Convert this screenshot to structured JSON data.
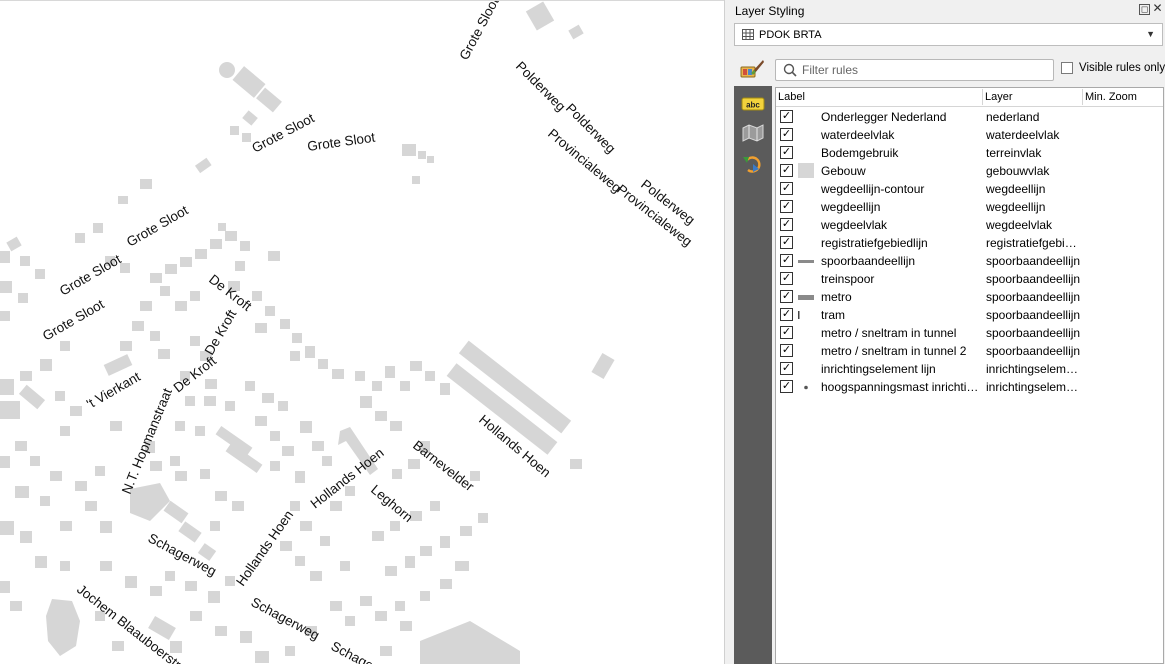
{
  "map": {
    "labels": [
      {
        "text": "Grote Sloot",
        "icon": "street-label"
      },
      {
        "text": "Grote Sloot"
      },
      {
        "text": "Grote Sloot"
      },
      {
        "text": "Grote Sloot"
      },
      {
        "text": "Grote Sloot"
      },
      {
        "text": "Grote Sloot"
      },
      {
        "text": "Polderweg"
      },
      {
        "text": "Polderweg"
      },
      {
        "text": "Polderweg"
      },
      {
        "text": "Provincialeweg"
      },
      {
        "text": "Provincialeweg"
      },
      {
        "text": "De Kroft"
      },
      {
        "text": "De Kroft"
      },
      {
        "text": "De Kroft"
      },
      {
        "text": "'t Vierkant"
      },
      {
        "text": "N.T. Hopmanstraat"
      },
      {
        "text": "Hollands Hoen"
      },
      {
        "text": "Hollands Hoen"
      },
      {
        "text": "Hollands Hoen"
      },
      {
        "text": "Barnevelder"
      },
      {
        "text": "Leghorn"
      },
      {
        "text": "Schagerweg"
      },
      {
        "text": "Schagerweg"
      },
      {
        "text": "Schager"
      },
      {
        "text": "Jochem Blaauboerstra"
      }
    ]
  },
  "panel": {
    "title": "Layer Styling",
    "layer_combo": {
      "value": "PDOK BRTA",
      "icon": "table-grid-icon"
    },
    "filter": {
      "placeholder": "Filter rules",
      "value": ""
    },
    "visible_only_label": "Visible rules only",
    "columns": [
      "Label",
      "Layer",
      "Min. Zoom"
    ],
    "rules": [
      {
        "label": "Onderlegger Nederland",
        "layer": "nederland",
        "symbol": "none",
        "checked": true
      },
      {
        "label": "waterdeelvlak",
        "layer": "waterdeelvlak",
        "symbol": "none",
        "checked": true
      },
      {
        "label": "Bodemgebruik",
        "layer": "terreinvlak",
        "symbol": "none",
        "checked": true
      },
      {
        "label": "Gebouw",
        "layer": "gebouwvlak",
        "symbol": "fill",
        "checked": true
      },
      {
        "label": "wegdeellijn-contour",
        "layer": "wegdeellijn",
        "symbol": "none",
        "checked": true
      },
      {
        "label": "wegdeellijn",
        "layer": "wegdeellijn",
        "symbol": "none",
        "checked": true
      },
      {
        "label": "wegdeelvlak",
        "layer": "wegdeelvlak",
        "symbol": "none",
        "checked": true
      },
      {
        "label": "registratiefgebiedlijn",
        "layer": "registratiefgebiedlijn",
        "symbol": "none",
        "checked": true
      },
      {
        "label": "spoorbaandeellijn",
        "layer": "spoorbaandeellijn",
        "symbol": "thin-line",
        "checked": true
      },
      {
        "label": "treinspoor",
        "layer": "spoorbaandeellijn",
        "symbol": "none",
        "checked": true
      },
      {
        "label": "metro",
        "layer": "spoorbaandeellijn",
        "symbol": "thick-line",
        "checked": true
      },
      {
        "label": "tram",
        "layer": "spoorbaandeellijn",
        "symbol": "tick",
        "checked": true
      },
      {
        "label": "metro / sneltram in tunnel",
        "layer": "spoorbaandeellijn",
        "symbol": "none",
        "checked": true
      },
      {
        "label": "metro / sneltram in tunnel 2",
        "layer": "spoorbaandeellijn",
        "symbol": "none",
        "checked": true
      },
      {
        "label": "inrichtingselement lijn",
        "layer": "inrichtingselement",
        "symbol": "none",
        "checked": true
      },
      {
        "label": "hoogspanningsmast inrichtingselement",
        "layer": "inrichtingselement",
        "symbol": "dot",
        "checked": true
      }
    ],
    "colors": {
      "building": "#d6d6d6",
      "toolstrip": "#5b5b5b",
      "panel_bg": "#f0f0f0"
    }
  }
}
